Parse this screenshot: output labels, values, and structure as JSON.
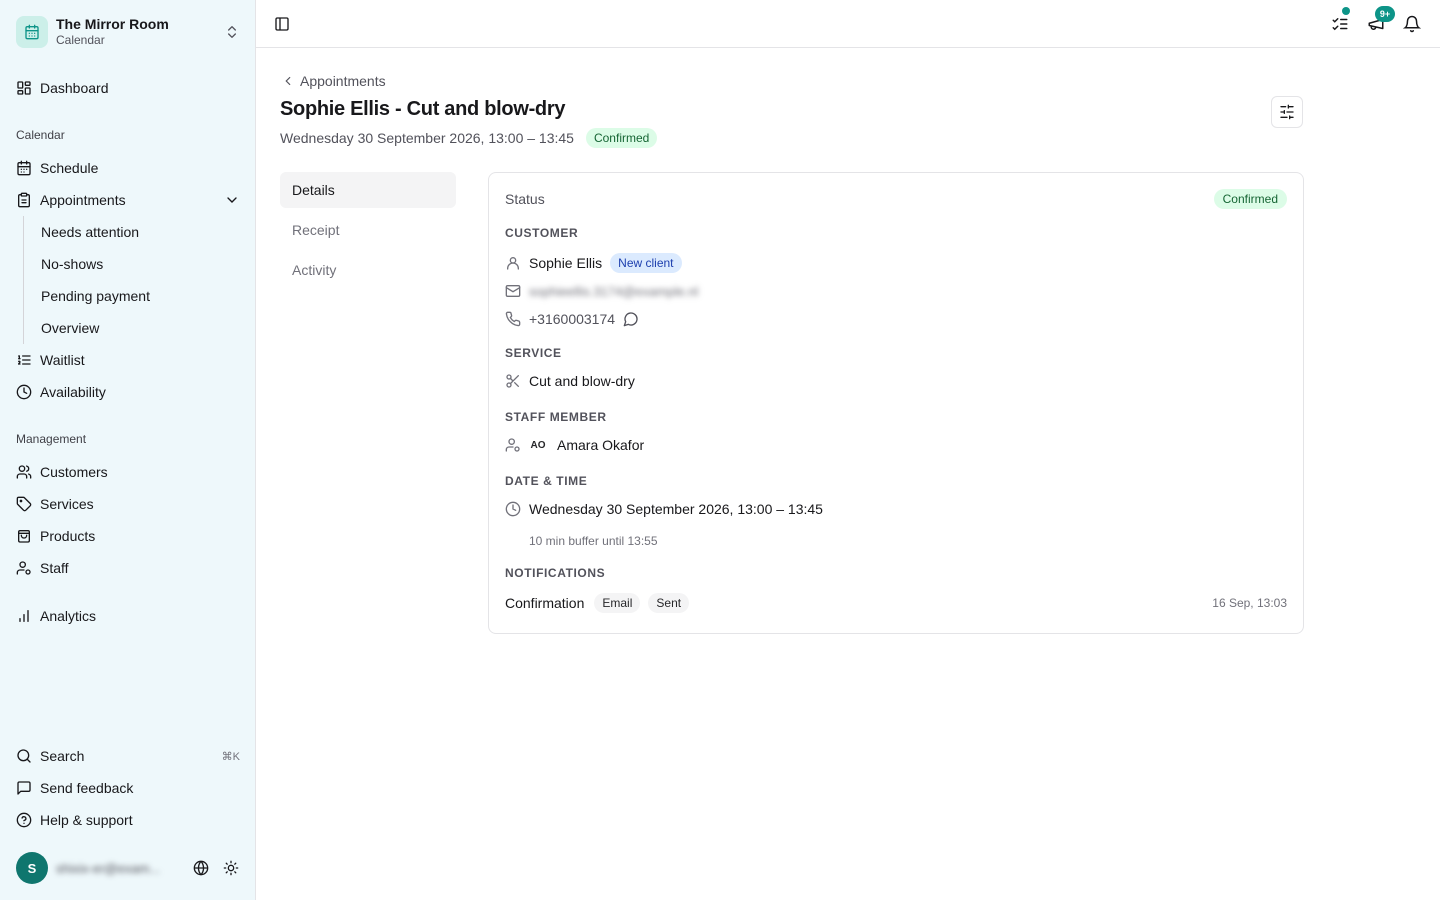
{
  "org": {
    "name": "The Mirror Room",
    "subtitle": "Calendar"
  },
  "nav": {
    "dashboard": "Dashboard",
    "calendar_group": "Calendar",
    "schedule": "Schedule",
    "appointments": "Appointments",
    "appointments_sub": [
      "Needs attention",
      "No-shows",
      "Pending payment",
      "Overview"
    ],
    "waitlist": "Waitlist",
    "availability": "Availability",
    "management_group": "Management",
    "customers": "Customers",
    "services": "Services",
    "products": "Products",
    "staff": "Staff",
    "analytics": "Analytics",
    "search": "Search",
    "search_shortcut": "⌘K",
    "feedback": "Send feedback",
    "help": "Help & support"
  },
  "user": {
    "initial": "S",
    "email": "shixix-er@exam..."
  },
  "topbar": {
    "updates_count": "9+"
  },
  "page": {
    "breadcrumb": "Appointments",
    "title": "Sophie Ellis - Cut and blow-dry",
    "datetime": "Wednesday 30 September 2026, 13:00 – 13:45",
    "status": "Confirmed"
  },
  "tabs": {
    "details": "Details",
    "receipt": "Receipt",
    "activity": "Activity"
  },
  "details": {
    "status_label": "Status",
    "status_value": "Confirmed",
    "customer_header": "CUSTOMER",
    "customer_name": "Sophie Ellis",
    "customer_tag": "New client",
    "customer_email": "sophieellis.3174@example.nl",
    "customer_phone": "+3160003174",
    "service_header": "SERVICE",
    "service_name": "Cut and blow-dry",
    "staff_header": "STAFF MEMBER",
    "staff_initials": "AO",
    "staff_name": "Amara Okafor",
    "datetime_header": "DATE & TIME",
    "datetime_value": "Wednesday 30 September 2026, 13:00 – 13:45",
    "buffer_note": "10 min buffer until 13:55",
    "notifications_header": "NOTIFICATIONS",
    "notification_type": "Confirmation",
    "notification_channel": "Email",
    "notification_status": "Sent",
    "notification_time": "16 Sep, 13:03"
  },
  "colors": {
    "accent": "#0d9488",
    "sidebar_bg": "#eef8fb",
    "success_bg": "#dcfce7",
    "success_fg": "#166534",
    "info_bg": "#dbeafe",
    "info_fg": "#1e40af"
  }
}
